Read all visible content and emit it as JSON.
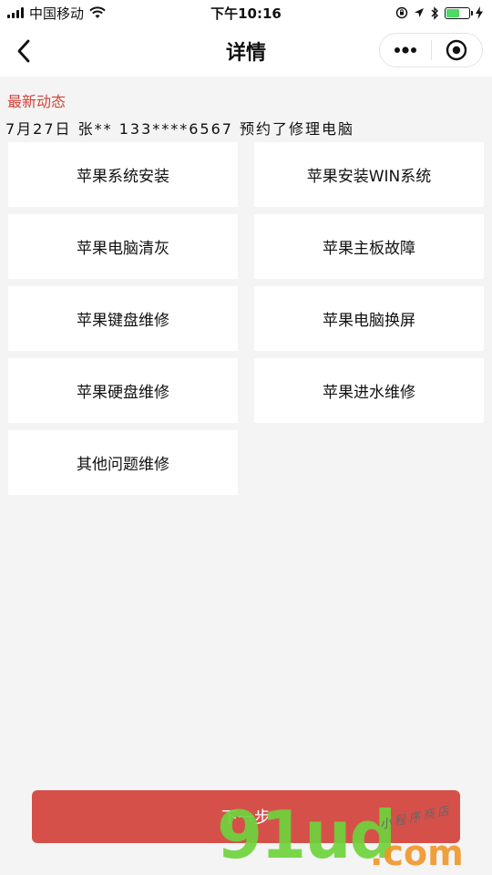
{
  "status_bar": {
    "carrier": "中国移动",
    "time": "下午10:16"
  },
  "nav": {
    "title": "详情"
  },
  "latest": {
    "section_title": "最新动态",
    "activity": "7月27日 张** 133****6567 预约了修理电脑"
  },
  "services": [
    "苹果系统安装",
    "苹果安装WIN系统",
    "苹果电脑清灰",
    "苹果主板故障",
    "苹果键盘维修",
    "苹果电脑换屏",
    "苹果硬盘维修",
    "苹果进水维修",
    "其他问题维修"
  ],
  "footer": {
    "next_label": "下一步"
  },
  "watermark": {
    "brand": "91ud",
    "suffix": ".com",
    "tagline": "小程序商店"
  },
  "colors": {
    "accent_red": "#d0443a",
    "button_red": "#d6504a",
    "background": "#f4f4f4",
    "battery_green": "#4cd964"
  },
  "battery_level": 0.6
}
